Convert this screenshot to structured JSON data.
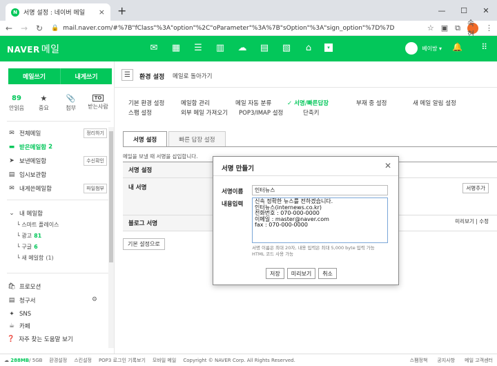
{
  "browser": {
    "tab_title": "서명 설정 : 네이버 메일",
    "tab_favicon": "N",
    "close_glyph": "×",
    "new_tab_glyph": "+",
    "window_controls": [
      "—",
      "☐",
      "✕"
    ],
    "url": "mail.naver.com/#%7B\"fClass\"%3A\"option\"%2C\"oParameter\"%3A%7B\"sOption\"%3A\"sign_option\"%7D%7D",
    "profile_badge": "속현"
  },
  "header": {
    "logo": "NAVER",
    "logo_suffix": "메일",
    "user_name": "베이방 ▾"
  },
  "sidebar": {
    "write_label": "메일쓰기",
    "write_self_label": "내게쓰기",
    "quick": [
      {
        "top": "89",
        "label": "안읽음"
      },
      {
        "top": "★",
        "label": "중요"
      },
      {
        "top": "📎",
        "label": "첨부"
      },
      {
        "top": "TO",
        "label": "받는사람"
      }
    ],
    "mailboxes": {
      "all": {
        "label": "전체메일",
        "button": "정리하기"
      },
      "inbox": {
        "label": "받은메일함",
        "count": "2"
      },
      "sent": {
        "label": "보낸메일함",
        "button": "수신확인"
      },
      "drafts": {
        "label": "임시보관함"
      },
      "self": {
        "label": "내게쓴메일함",
        "button": "파일첨부"
      }
    },
    "my_folders_label": "내 메일함",
    "folders": [
      {
        "name": "스마트 플레이스",
        "count": ""
      },
      {
        "name": "광고",
        "count": "81"
      },
      {
        "name": "구글",
        "count": "6"
      },
      {
        "name": "새 메일함",
        "count": "(1)"
      }
    ],
    "extras": {
      "promo": "프로모션",
      "bills": "청구서",
      "sns": "SNS",
      "cafe": "카페"
    },
    "help": "자주 찾는 도움말 보기"
  },
  "main": {
    "breadcrumb_title": "환경 설정",
    "breadcrumb_link": "메일로 돌아가기",
    "settings_menu": {
      "basic": "기본 환경 설정",
      "mail_mgmt": "메일함 관리",
      "auto_sort": "메일 자동 분류",
      "signature": "✓ 서명/빠른답장",
      "absence": "부재 중 설정",
      "new_alert": "새 메일 알림 설정",
      "spam": "스팸 설정",
      "import": "외부 메일 가져오기",
      "pop3": "POP3/IMAP 설정",
      "shortcut": "단축키"
    },
    "subtabs": {
      "signature": "서명 설정",
      "quick_reply": "빠른 답장 설정"
    },
    "description": "메일을 보낼 때 서명을 삽입합니다.",
    "rows": {
      "sig_setting": "서명 설정",
      "my_sig": "내 서명",
      "blog_sig": "블로그 서명"
    },
    "add_sig_button": "서명추가",
    "preview_link": "미리보기",
    "edit_link": "수정",
    "reset_button": "기본 설정으로"
  },
  "modal": {
    "title": "서명 만들기",
    "name_label": "서명이름",
    "name_value": "인터뉴스",
    "content_label": "내용입력",
    "content_lines": [
      "신속 정확한 뉴스를 전하겠습니다.",
      "인터뉴스(internews.co.kr)",
      "전화번호 : 070-000-0000",
      "이메일 : master@naver.com",
      "fax : 070-000-0000"
    ],
    "hint_line1": "서명 이름은 최대 20자, 내용 입력은 최대 5,000 byte 입력 가능",
    "hint_line2": "HTML 코드 사용 가능",
    "save": "저장",
    "preview": "미리보기",
    "cancel": "취소"
  },
  "footer": {
    "storage_used": "288MB",
    "storage_total": "/ 5GB",
    "links": [
      "환경설정",
      "스킨설정",
      "POP3 로그인 기록보기",
      "모바일 메일"
    ],
    "copyright": "Copyright © NAVER Corp. All Rights Reserved.",
    "right_links": [
      "스팸정책",
      "공지사항",
      "메일 고객센터"
    ]
  }
}
